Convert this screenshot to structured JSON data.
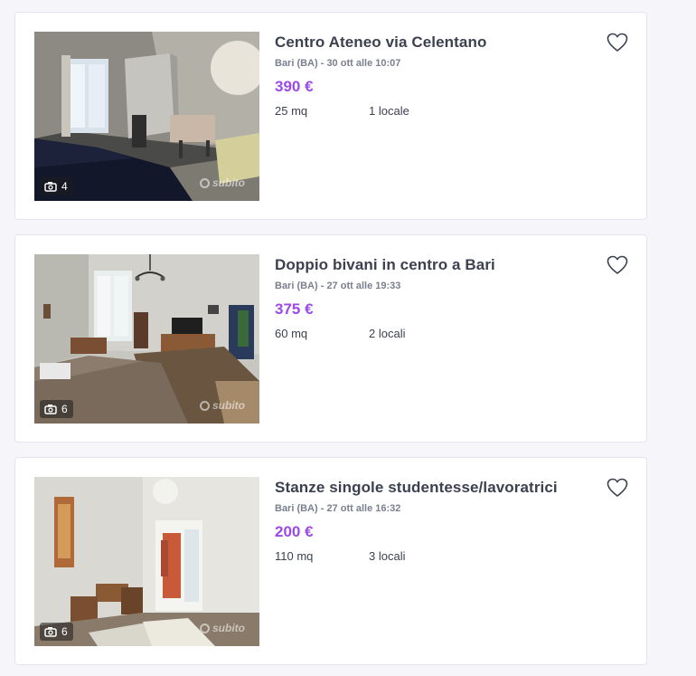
{
  "listings": [
    {
      "title": "Centro Ateneo via Celentano",
      "meta": "Bari (BA) - 30 ott alle 10:07",
      "price": "390 €",
      "size": "25 mq",
      "rooms": "1 locale",
      "photo_count": "4",
      "watermark": "subito"
    },
    {
      "title": "Doppio bivani in centro a Bari",
      "meta": "Bari (BA) - 27 ott alle 19:33",
      "price": "375 €",
      "size": "60 mq",
      "rooms": "2 locali",
      "photo_count": "6",
      "watermark": "subito"
    },
    {
      "title": "Stanze singole studentesse/lavoratrici",
      "meta": "Bari (BA) - 27 ott alle 16:32",
      "price": "200 €",
      "size": "110 mq",
      "rooms": "3 locali",
      "photo_count": "6",
      "watermark": "subito"
    }
  ],
  "icons": {
    "favorite": "heart-outline-icon",
    "photos": "camera-icon"
  },
  "colors": {
    "price": "#9b49e8",
    "title": "#3c4150",
    "meta": "#7a7f8f",
    "card_border": "#e3e5ee"
  }
}
